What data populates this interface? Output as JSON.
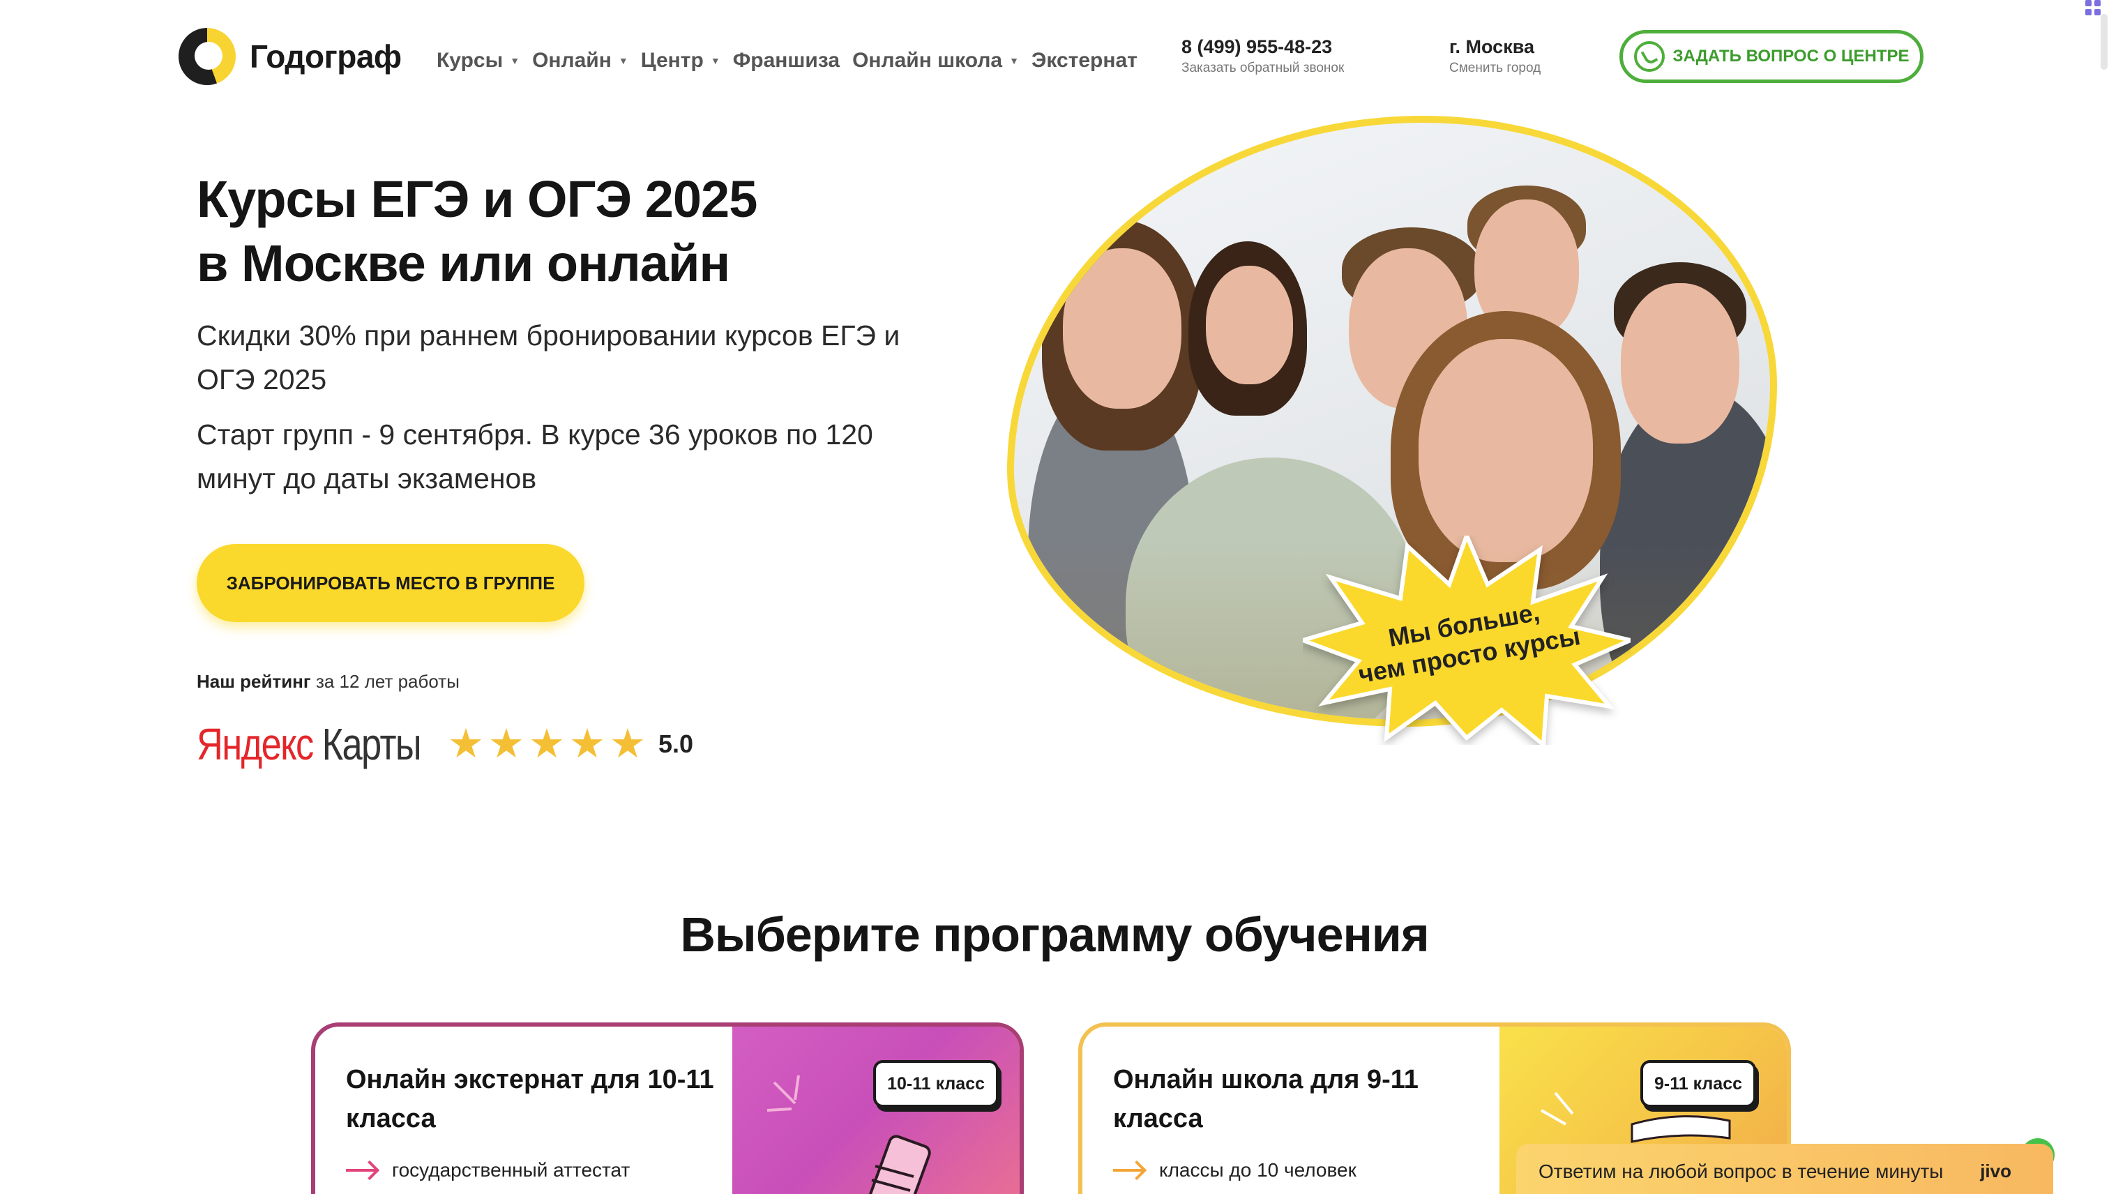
{
  "header": {
    "logo_text": "Годограф",
    "nav": [
      {
        "label": "Курсы",
        "dropdown": true
      },
      {
        "label": "Онлайн",
        "dropdown": true
      },
      {
        "label": "Центр",
        "dropdown": true
      },
      {
        "label": "Франшиза",
        "dropdown": false
      },
      {
        "label": "Онлайн школа",
        "dropdown": true
      },
      {
        "label": "Экстернат",
        "dropdown": false
      }
    ],
    "phone": "8 (499) 955-48-23",
    "phone_sub": "Заказать обратный звонок",
    "city": "г. Москва",
    "city_sub": "Сменить город",
    "ask_button": "ЗАДАТЬ ВОПРОС О ЦЕНТРЕ"
  },
  "hero": {
    "title_line1": "Курсы ЕГЭ и ОГЭ 2025",
    "title_line2": "в Москве или онлайн",
    "subtitle": "Скидки 30% при раннем бронировании курсов ЕГЭ и ОГЭ 2025",
    "start_text": "Старт групп - 9 сентября. В курсе 36 уроков по 120 минут до даты экзаменов",
    "cta": "ЗАБРОНИРОВАТЬ МЕСТО В ГРУППЕ",
    "rating_label_bold": "Наш рейтинг",
    "rating_label_rest": " за 12 лет работы",
    "yandex_ya": "Яндекс",
    "yandex_rest": " Карты",
    "rating_value": "5.0",
    "stars": 5,
    "burst_line1": "Мы больше,",
    "burst_line2": "чем просто курсы"
  },
  "programs": {
    "title": "Выберите программу обучения",
    "cards": [
      {
        "title": "Онлайн экстернат для 10-11 класса",
        "badge": "10-11 класс",
        "feature": "государственный аттестат"
      },
      {
        "title": "Онлайн школа для 9-11 класса",
        "badge": "9-11 класс",
        "feature": "классы до 10 человек"
      }
    ]
  },
  "chat": {
    "text": "Ответим на любой вопрос в течение минуты",
    "brand": "jivo"
  },
  "colors": {
    "accent_yellow": "#fbd92c",
    "whatsapp_green": "#4eae3b",
    "card1_border": "#a83e74",
    "card2_border": "#f3c14f"
  }
}
